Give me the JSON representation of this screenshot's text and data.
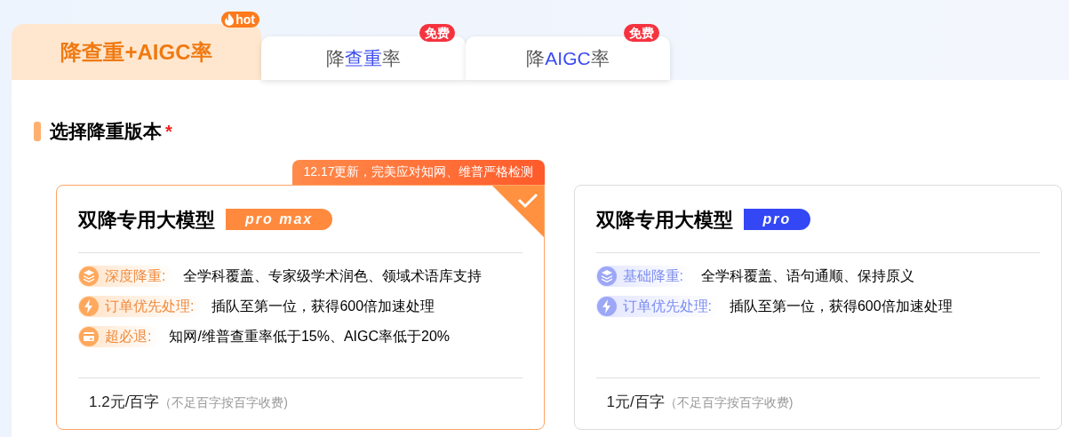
{
  "tabs": [
    {
      "selected": true,
      "badge": {
        "kind": "hot",
        "text": "hot"
      },
      "segments": [
        {
          "text": "降查重+AIGC率",
          "highlight": false
        }
      ]
    },
    {
      "selected": false,
      "badge": {
        "kind": "free",
        "text": "免费"
      },
      "segments": [
        {
          "text": "降",
          "highlight": false
        },
        {
          "text": "查重",
          "highlight": true
        },
        {
          "text": "率",
          "highlight": false
        }
      ]
    },
    {
      "selected": false,
      "badge": {
        "kind": "free",
        "text": "免费"
      },
      "segments": [
        {
          "text": "降",
          "highlight": false
        },
        {
          "text": "AIGC",
          "highlight": true
        },
        {
          "text": "率",
          "highlight": false
        }
      ]
    }
  ],
  "section": {
    "title": "选择降重版本",
    "required_mark": "*"
  },
  "cards": [
    {
      "selected": true,
      "banner": "12.17更新，完美应对知网、维普严格检测",
      "title": "双降专用大模型",
      "tier": "pro max",
      "color": "#ff8a3d",
      "features": [
        {
          "kind": "quality",
          "label": "深度降重:",
          "text": "全学科覆盖、专家级学术润色、领域术语库支持"
        },
        {
          "kind": "priority",
          "label": "订单优先处理:",
          "text": "插队至第一位，获得600倍加速处理"
        },
        {
          "kind": "guarantee",
          "label": "超必退:",
          "text": "知网/维普查重率低于15%、AIGC率低于20%"
        }
      ],
      "price": "1.2元/百字",
      "price_note": "（不足百字按百字收费)"
    },
    {
      "selected": false,
      "title": "双降专用大模型",
      "tier": "pro",
      "color": "#3347f5",
      "features": [
        {
          "kind": "quality",
          "label": "基础降重:",
          "text": "全学科覆盖、语句通顺、保持原义"
        },
        {
          "kind": "priority",
          "label": "订单优先处理:",
          "text": "插队至第一位，获得600倍加速处理"
        }
      ],
      "price": "1元/百字",
      "price_note": "（不足百字按百字收费)"
    }
  ]
}
